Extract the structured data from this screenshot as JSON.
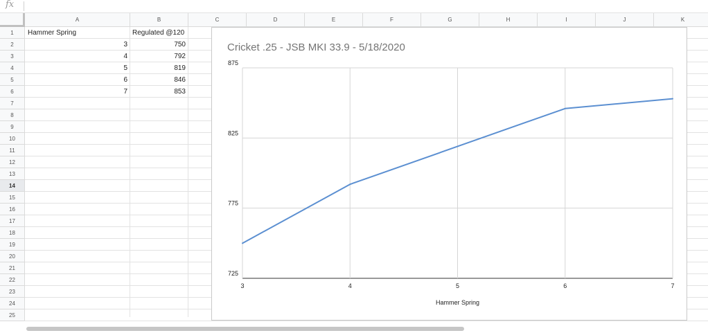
{
  "formula_bar": {
    "fx_label": "fx",
    "value": ""
  },
  "columns": [
    "A",
    "B",
    "C",
    "D",
    "E",
    "F",
    "G",
    "H",
    "I",
    "J",
    "K"
  ],
  "rows": [
    "1",
    "2",
    "3",
    "4",
    "5",
    "6",
    "7",
    "8",
    "9",
    "10",
    "11",
    "12",
    "13",
    "14",
    "15",
    "16",
    "17",
    "18",
    "19",
    "20",
    "21",
    "22",
    "23",
    "24",
    "25"
  ],
  "selected_row": "14",
  "cells": {
    "A1": "Hammer Spring",
    "B1": "Regulated @120",
    "A2": "3",
    "B2": "750",
    "A3": "4",
    "B3": "792",
    "A4": "5",
    "B4": "819",
    "A5": "6",
    "B5": "846",
    "A6": "7",
    "B6": "853"
  },
  "chart_data": {
    "type": "line",
    "title": "Cricket .25 - JSB MKI 33.9 - 5/18/2020",
    "xlabel": "Hammer Spring",
    "ylabel": "",
    "x": [
      3,
      4,
      5,
      6,
      7
    ],
    "series": [
      {
        "values": [
          750,
          792,
          819,
          846,
          853
        ],
        "color": "#5b8fd1"
      }
    ],
    "xlim": [
      3,
      7
    ],
    "ylim": [
      725,
      875
    ],
    "x_ticks": [
      "3",
      "4",
      "5",
      "6",
      "7"
    ],
    "y_ticks": [
      "725",
      "775",
      "825",
      "875"
    ],
    "grid": true,
    "legend": "none"
  }
}
